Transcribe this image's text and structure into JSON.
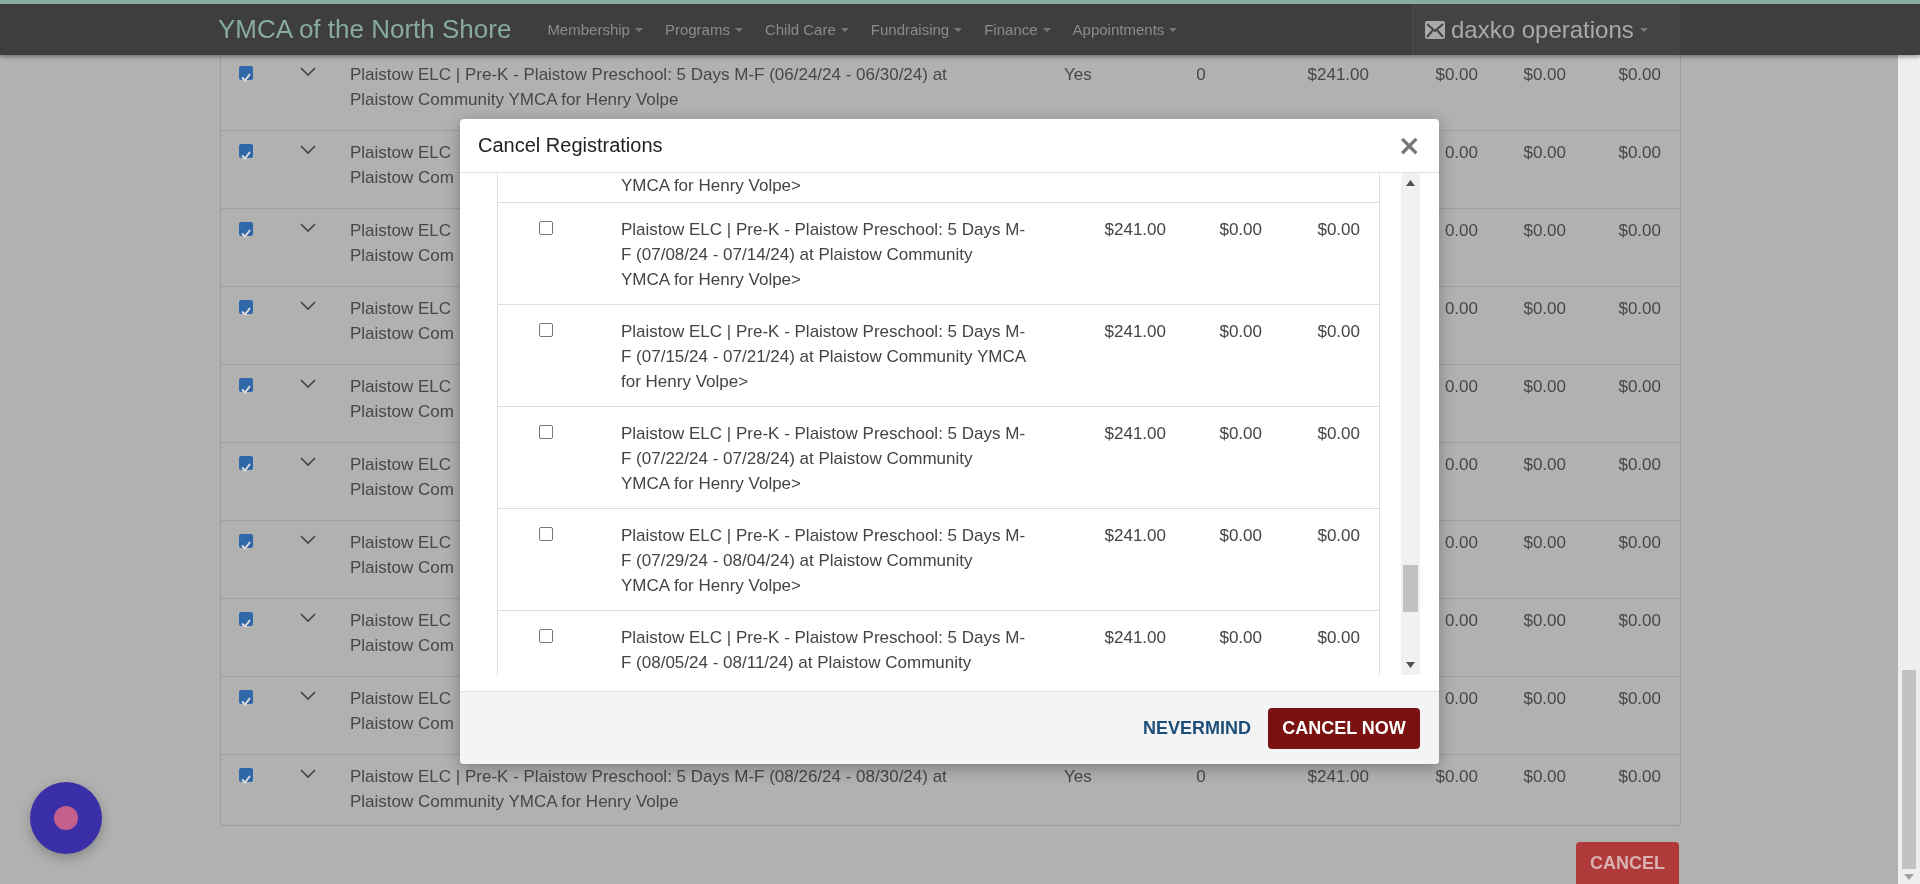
{
  "header": {
    "title": "YMCA of the North Shore",
    "menu": [
      {
        "label": "Membership"
      },
      {
        "label": "Programs"
      },
      {
        "label": "Child Care"
      },
      {
        "label": "Fundraising"
      },
      {
        "label": "Finance"
      },
      {
        "label": "Appointments"
      }
    ],
    "brand": "daxko operations"
  },
  "registrations": [
    {
      "kind": "full",
      "checked": true,
      "description": [
        "Plaistow ELC | Pre-K - Plaistow Preschool: 5 Days M-F (06/24/24 - 06/30/24) at",
        "Plaistow Community YMCA for Henry Volpe"
      ],
      "cells": [
        "Yes",
        "0",
        "$241.00",
        "$0.00",
        "$0.00",
        "$0.00"
      ]
    },
    {
      "kind": "covered",
      "checked": true,
      "description": [
        "Plaistow ELC",
        "Plaistow Com"
      ],
      "cells": [
        "0.00",
        "$0.00",
        "$0.00"
      ]
    },
    {
      "kind": "covered",
      "checked": true,
      "description": [
        "Plaistow ELC",
        "Plaistow Com"
      ],
      "cells": [
        "0.00",
        "$0.00",
        "$0.00"
      ]
    },
    {
      "kind": "covered",
      "checked": true,
      "description": [
        "Plaistow ELC",
        "Plaistow Com"
      ],
      "cells": [
        "0.00",
        "$0.00",
        "$0.00"
      ]
    },
    {
      "kind": "covered",
      "checked": true,
      "description": [
        "Plaistow ELC",
        "Plaistow Com"
      ],
      "cells": [
        "0.00",
        "$0.00",
        "$0.00"
      ]
    },
    {
      "kind": "covered",
      "checked": true,
      "description": [
        "Plaistow ELC",
        "Plaistow Com"
      ],
      "cells": [
        "0.00",
        "$0.00",
        "$0.00"
      ]
    },
    {
      "kind": "covered",
      "checked": true,
      "description": [
        "Plaistow ELC",
        "Plaistow Com"
      ],
      "cells": [
        "0.00",
        "$0.00",
        "$0.00"
      ]
    },
    {
      "kind": "covered",
      "checked": true,
      "description": [
        "Plaistow ELC",
        "Plaistow Com"
      ],
      "cells": [
        "0.00",
        "$0.00",
        "$0.00"
      ]
    },
    {
      "kind": "covered",
      "checked": true,
      "description": [
        "Plaistow ELC",
        "Plaistow Com"
      ],
      "cells": [
        "0.00",
        "$0.00",
        "$0.00"
      ]
    },
    {
      "kind": "full",
      "checked": true,
      "description": [
        "Plaistow ELC | Pre-K - Plaistow Preschool: 5 Days M-F (08/26/24 - 08/30/24) at",
        "Plaistow Community YMCA for Henry Volpe"
      ],
      "cells": [
        "Yes",
        "0",
        "$241.00",
        "$0.00",
        "$0.00",
        "$0.00"
      ]
    }
  ],
  "cancel_button": "CANCEL",
  "modal": {
    "title": "Cancel Registrations",
    "close": "×",
    "rows": [
      {
        "kind": "partial",
        "description": [
          "YMCA for Henry Volpe>"
        ]
      },
      {
        "kind": "full",
        "checked": false,
        "description": [
          "Plaistow ELC | Pre-K - Plaistow Preschool: 5 Days M-",
          "F (07/08/24 - 07/14/24) at Plaistow Community",
          "YMCA for Henry Volpe>"
        ],
        "cells": [
          "$241.00",
          "$0.00",
          "$0.00"
        ]
      },
      {
        "kind": "full",
        "checked": false,
        "description": [
          "Plaistow ELC | Pre-K - Plaistow Preschool: 5 Days M-",
          "F (07/15/24 - 07/21/24) at Plaistow Community YMCA",
          "for Henry Volpe>"
        ],
        "cells": [
          "$241.00",
          "$0.00",
          "$0.00"
        ]
      },
      {
        "kind": "full",
        "checked": false,
        "description": [
          "Plaistow ELC | Pre-K - Plaistow Preschool: 5 Days M-",
          "F (07/22/24 - 07/28/24) at Plaistow Community",
          "YMCA for Henry Volpe>"
        ],
        "cells": [
          "$241.00",
          "$0.00",
          "$0.00"
        ]
      },
      {
        "kind": "full",
        "checked": false,
        "description": [
          "Plaistow ELC | Pre-K - Plaistow Preschool: 5 Days M-",
          "F (07/29/24 - 08/04/24) at Plaistow Community",
          "YMCA for Henry Volpe>"
        ],
        "cells": [
          "$241.00",
          "$0.00",
          "$0.00"
        ]
      },
      {
        "kind": "full",
        "checked": false,
        "description": [
          "Plaistow ELC | Pre-K - Plaistow Preschool: 5 Days M-",
          "F (08/05/24 - 08/11/24) at Plaistow Community"
        ],
        "cells": [
          "$241.00",
          "$0.00",
          "$0.00"
        ]
      }
    ],
    "secondary_button": "NEVERMIND",
    "primary_button": "CANCEL NOW"
  }
}
